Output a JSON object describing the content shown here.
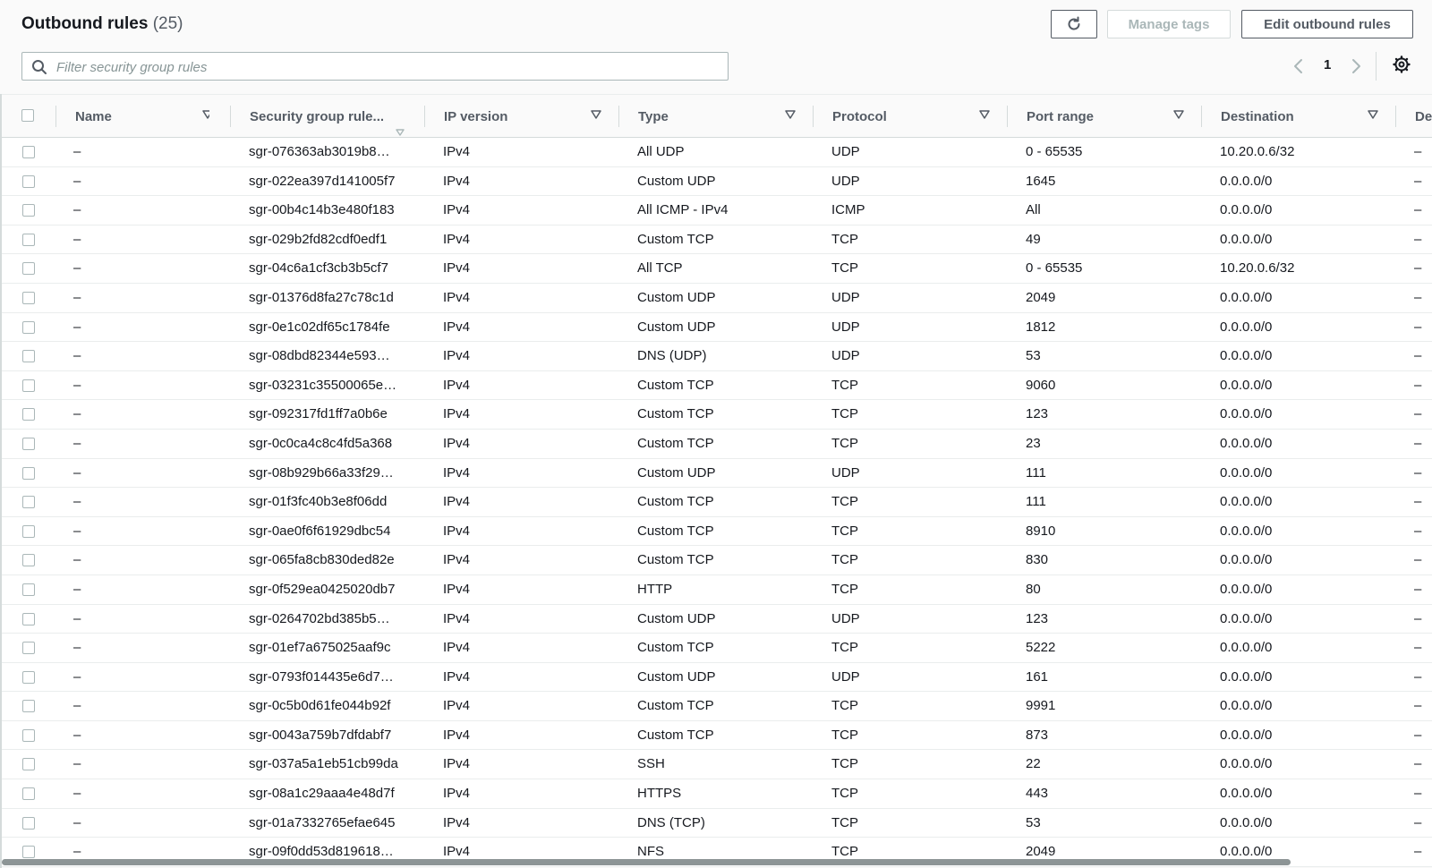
{
  "header": {
    "title": "Outbound rules",
    "count": "(25)",
    "manage_tags_label": "Manage tags",
    "edit_label": "Edit outbound rules"
  },
  "filter": {
    "placeholder": "Filter security group rules"
  },
  "pagination": {
    "current_page": "1"
  },
  "icons": {
    "refresh": "refresh-icon",
    "search": "search-icon",
    "prev": "chevron-left-icon",
    "next": "chevron-right-icon",
    "settings": "gear-icon",
    "sort": "caret-down-icon"
  },
  "colors": {
    "border": "#d5dbdb",
    "text": "#16191f",
    "muted": "#545b64",
    "disabled": "#aab7b8"
  },
  "columns": {
    "name": "Name",
    "rule_id": "Security group rule...",
    "ip_version": "IP version",
    "type": "Type",
    "protocol": "Protocol",
    "port_range": "Port range",
    "destination": "Destination",
    "description": "De"
  },
  "rows": [
    {
      "name": "–",
      "id": "sgr-076363ab3019b8…",
      "ip": "IPv4",
      "type": "All UDP",
      "protocol": "UDP",
      "port": "0 - 65535",
      "dest": "10.20.0.6/32",
      "desc": "–"
    },
    {
      "name": "–",
      "id": "sgr-022ea397d141005f7",
      "ip": "IPv4",
      "type": "Custom UDP",
      "protocol": "UDP",
      "port": "1645",
      "dest": "0.0.0.0/0",
      "desc": "–"
    },
    {
      "name": "–",
      "id": "sgr-00b4c14b3e480f183",
      "ip": "IPv4",
      "type": "All ICMP - IPv4",
      "protocol": "ICMP",
      "port": "All",
      "dest": "0.0.0.0/0",
      "desc": "–"
    },
    {
      "name": "–",
      "id": "sgr-029b2fd82cdf0edf1",
      "ip": "IPv4",
      "type": "Custom TCP",
      "protocol": "TCP",
      "port": "49",
      "dest": "0.0.0.0/0",
      "desc": "–"
    },
    {
      "name": "–",
      "id": "sgr-04c6a1cf3cb3b5cf7",
      "ip": "IPv4",
      "type": "All TCP",
      "protocol": "TCP",
      "port": "0 - 65535",
      "dest": "10.20.0.6/32",
      "desc": "–"
    },
    {
      "name": "–",
      "id": "sgr-01376d8fa27c78c1d",
      "ip": "IPv4",
      "type": "Custom UDP",
      "protocol": "UDP",
      "port": "2049",
      "dest": "0.0.0.0/0",
      "desc": "–"
    },
    {
      "name": "–",
      "id": "sgr-0e1c02df65c1784fe",
      "ip": "IPv4",
      "type": "Custom UDP",
      "protocol": "UDP",
      "port": "1812",
      "dest": "0.0.0.0/0",
      "desc": "–"
    },
    {
      "name": "–",
      "id": "sgr-08dbd82344e593…",
      "ip": "IPv4",
      "type": "DNS (UDP)",
      "protocol": "UDP",
      "port": "53",
      "dest": "0.0.0.0/0",
      "desc": "–"
    },
    {
      "name": "–",
      "id": "sgr-03231c35500065e…",
      "ip": "IPv4",
      "type": "Custom TCP",
      "protocol": "TCP",
      "port": "9060",
      "dest": "0.0.0.0/0",
      "desc": "–"
    },
    {
      "name": "–",
      "id": "sgr-092317fd1ff7a0b6e",
      "ip": "IPv4",
      "type": "Custom TCP",
      "protocol": "TCP",
      "port": "123",
      "dest": "0.0.0.0/0",
      "desc": "–"
    },
    {
      "name": "–",
      "id": "sgr-0c0ca4c8c4fd5a368",
      "ip": "IPv4",
      "type": "Custom TCP",
      "protocol": "TCP",
      "port": "23",
      "dest": "0.0.0.0/0",
      "desc": "–"
    },
    {
      "name": "–",
      "id": "sgr-08b929b66a33f29…",
      "ip": "IPv4",
      "type": "Custom UDP",
      "protocol": "UDP",
      "port": "111",
      "dest": "0.0.0.0/0",
      "desc": "–"
    },
    {
      "name": "–",
      "id": "sgr-01f3fc40b3e8f06dd",
      "ip": "IPv4",
      "type": "Custom TCP",
      "protocol": "TCP",
      "port": "111",
      "dest": "0.0.0.0/0",
      "desc": "–"
    },
    {
      "name": "–",
      "id": "sgr-0ae0f6f61929dbc54",
      "ip": "IPv4",
      "type": "Custom TCP",
      "protocol": "TCP",
      "port": "8910",
      "dest": "0.0.0.0/0",
      "desc": "–"
    },
    {
      "name": "–",
      "id": "sgr-065fa8cb830ded82e",
      "ip": "IPv4",
      "type": "Custom TCP",
      "protocol": "TCP",
      "port": "830",
      "dest": "0.0.0.0/0",
      "desc": "–"
    },
    {
      "name": "–",
      "id": "sgr-0f529ea0425020db7",
      "ip": "IPv4",
      "type": "HTTP",
      "protocol": "TCP",
      "port": "80",
      "dest": "0.0.0.0/0",
      "desc": "–"
    },
    {
      "name": "–",
      "id": "sgr-0264702bd385b5…",
      "ip": "IPv4",
      "type": "Custom UDP",
      "protocol": "UDP",
      "port": "123",
      "dest": "0.0.0.0/0",
      "desc": "–"
    },
    {
      "name": "–",
      "id": "sgr-01ef7a675025aaf9c",
      "ip": "IPv4",
      "type": "Custom TCP",
      "protocol": "TCP",
      "port": "5222",
      "dest": "0.0.0.0/0",
      "desc": "–"
    },
    {
      "name": "–",
      "id": "sgr-0793f014435e6d7…",
      "ip": "IPv4",
      "type": "Custom UDP",
      "protocol": "UDP",
      "port": "161",
      "dest": "0.0.0.0/0",
      "desc": "–"
    },
    {
      "name": "–",
      "id": "sgr-0c5b0d61fe044b92f",
      "ip": "IPv4",
      "type": "Custom TCP",
      "protocol": "TCP",
      "port": "9991",
      "dest": "0.0.0.0/0",
      "desc": "–"
    },
    {
      "name": "–",
      "id": "sgr-0043a759b7dfdabf7",
      "ip": "IPv4",
      "type": "Custom TCP",
      "protocol": "TCP",
      "port": "873",
      "dest": "0.0.0.0/0",
      "desc": "–"
    },
    {
      "name": "–",
      "id": "sgr-037a5a1eb51cb99da",
      "ip": "IPv4",
      "type": "SSH",
      "protocol": "TCP",
      "port": "22",
      "dest": "0.0.0.0/0",
      "desc": "–"
    },
    {
      "name": "–",
      "id": "sgr-08a1c29aaa4e48d7f",
      "ip": "IPv4",
      "type": "HTTPS",
      "protocol": "TCP",
      "port": "443",
      "dest": "0.0.0.0/0",
      "desc": "–"
    },
    {
      "name": "–",
      "id": "sgr-01a7332765efae645",
      "ip": "IPv4",
      "type": "DNS (TCP)",
      "protocol": "TCP",
      "port": "53",
      "dest": "0.0.0.0/0",
      "desc": "–"
    },
    {
      "name": "–",
      "id": "sgr-09f0dd53d819618…",
      "ip": "IPv4",
      "type": "NFS",
      "protocol": "TCP",
      "port": "2049",
      "dest": "0.0.0.0/0",
      "desc": "–"
    }
  ]
}
